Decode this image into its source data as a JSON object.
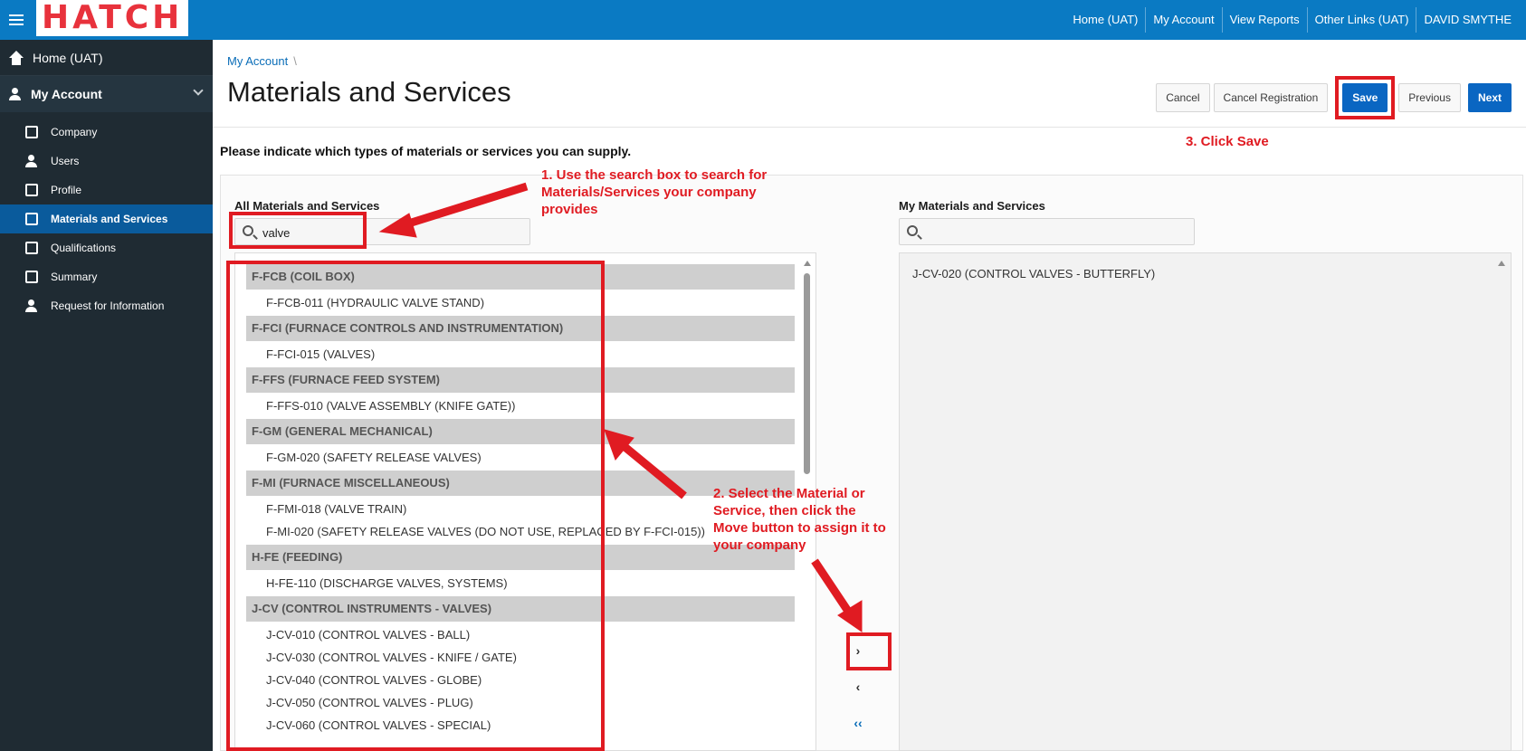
{
  "header": {
    "logo_text": "HATCH",
    "nav": [
      "Home (UAT)",
      "My Account",
      "View Reports",
      "Other Links (UAT)",
      "DAVID SMYTHE"
    ]
  },
  "sidebar": {
    "home": "Home (UAT)",
    "account": "My Account",
    "items": [
      "Company",
      "Users",
      "Profile",
      "Materials and Services",
      "Qualifications",
      "Summary",
      "Request for Information"
    ]
  },
  "breadcrumb": "My Account",
  "page_title": "Materials and Services",
  "buttons": {
    "cancel": "Cancel",
    "cancel_registration": "Cancel Registration",
    "save": "Save",
    "previous": "Previous",
    "next": "Next"
  },
  "intro": "Please indicate which types of materials or services you can supply.",
  "left_list": {
    "label": "All Materials and Services",
    "search_value": "valve",
    "groups": [
      {
        "name": "F-FCB (COIL BOX)",
        "items": [
          "F-FCB-011 (HYDRAULIC VALVE STAND)"
        ]
      },
      {
        "name": "F-FCI (FURNACE CONTROLS AND INSTRUMENTATION)",
        "items": [
          "F-FCI-015 (VALVES)"
        ]
      },
      {
        "name": "F-FFS (FURNACE FEED SYSTEM)",
        "items": [
          "F-FFS-010 (VALVE ASSEMBLY (KNIFE GATE))"
        ]
      },
      {
        "name": "F-GM (GENERAL MECHANICAL)",
        "items": [
          "F-GM-020 (SAFETY RELEASE VALVES)"
        ]
      },
      {
        "name": "F-MI (FURNACE MISCELLANEOUS)",
        "items": [
          "F-FMI-018 (VALVE TRAIN)",
          "F-MI-020 (SAFETY RELEASE VALVES (DO NOT USE, REPLACED BY F-FCI-015))"
        ]
      },
      {
        "name": "H-FE (FEEDING)",
        "items": [
          "H-FE-110 (DISCHARGE VALVES, SYSTEMS)"
        ]
      },
      {
        "name": "J-CV (CONTROL INSTRUMENTS - VALVES)",
        "items": [
          "J-CV-010 (CONTROL VALVES - BALL)",
          "J-CV-030 (CONTROL VALVES - KNIFE / GATE)",
          "J-CV-040 (CONTROL VALVES - GLOBE)",
          "J-CV-050 (CONTROL VALVES - PLUG)",
          "J-CV-060 (CONTROL VALVES - SPECIAL)"
        ]
      }
    ]
  },
  "right_list": {
    "label": "My Materials and Services",
    "search_value": "",
    "items": [
      "J-CV-020 (CONTROL VALVES - BUTTERFLY)"
    ]
  },
  "shuttle": {
    "move_all": "››",
    "move": "›",
    "remove": "‹",
    "remove_all": "‹‹"
  },
  "annotations": {
    "step1": "1. Use the search box to search for Materials/Services your company provides",
    "step2": "2. Select the Material or Service, then click the Move button to assign it to your company",
    "step3": "3. Click Save"
  },
  "colors": {
    "header": "#0a7ac3",
    "sidebar": "#1f2b33",
    "active": "#0a5b9c",
    "primary": "#0a66c2",
    "annotation": "#e01b22"
  }
}
